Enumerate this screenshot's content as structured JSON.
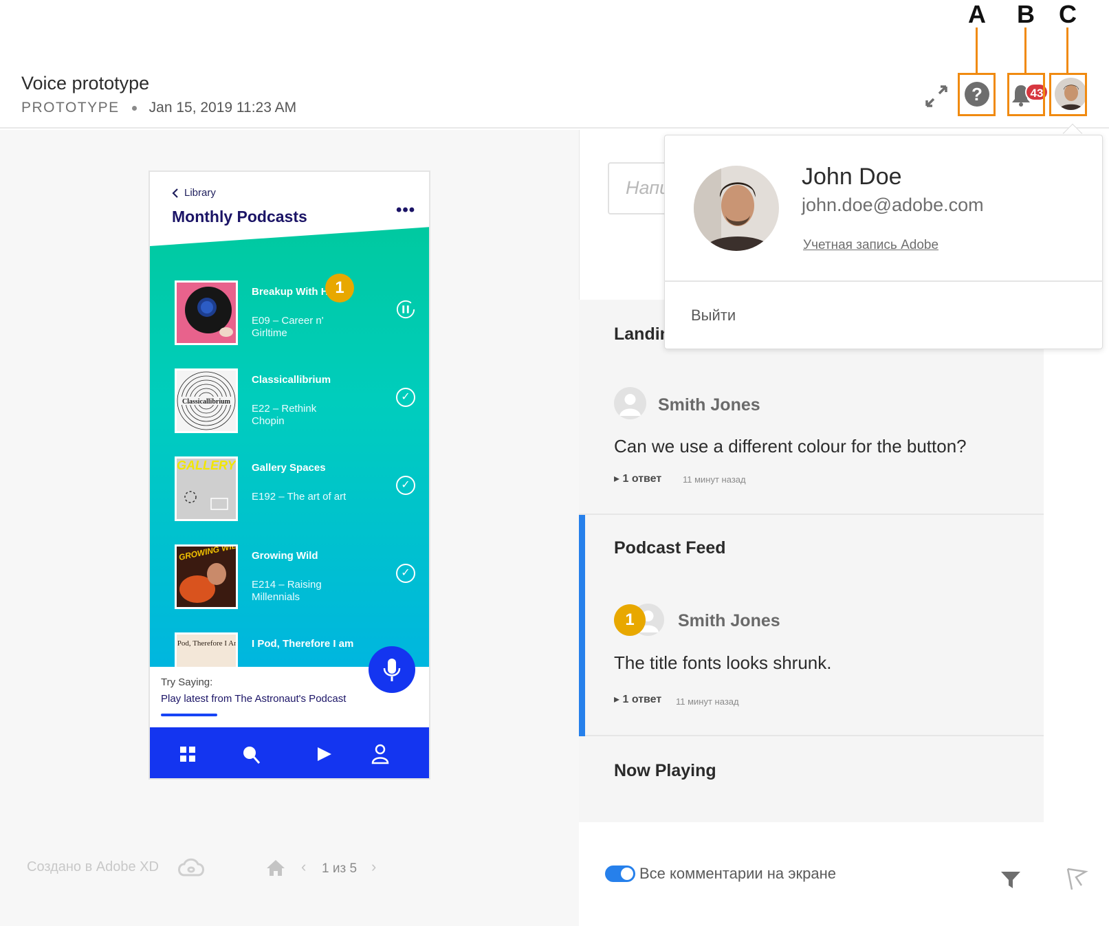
{
  "header": {
    "title": "Voice prototype",
    "type": "PROTOTYPE",
    "date": "Jan 15, 2019 11:23 AM",
    "notification_count": "43",
    "callouts": [
      "A",
      "B",
      "C"
    ]
  },
  "phone": {
    "back_label": "Library",
    "title": "Monthly Podcasts",
    "more": "•••",
    "podcasts": [
      {
        "name": "Breakup With H",
        "episode": "E09 – Career n' Girltime"
      },
      {
        "name": "Classicallibrium",
        "episode": "E22 – Rethink Chopin"
      },
      {
        "name": "Gallery Spaces",
        "episode": "E192 – The art of art"
      },
      {
        "name": "Growing Wild",
        "episode": "E214 – Raising Millennials"
      },
      {
        "name": "I Pod, Therefore I am",
        "episode": ""
      }
    ],
    "art_labels": {
      "classical": "Classicallibrium",
      "gallery": "GALLERY SPACES",
      "growing": "GROWING WILD",
      "ipod": "I Pod, Therefore I Am"
    },
    "marker": "1",
    "try_label": "Try Saying:",
    "try_phrase": "Play latest from The Astronaut's Podcast"
  },
  "canvas_footer": {
    "made_with": "Создано в Adobe XD",
    "pager": "1 из 5"
  },
  "panel": {
    "search_placeholder": "Напи",
    "groups": [
      {
        "title": "Landing",
        "author": "Smith Jones",
        "text": "Can we use a different colour for the button?",
        "replies": "1 ответ",
        "time": "11 минут назад"
      },
      {
        "title": "Podcast Feed",
        "marker": "1",
        "author": "Smith Jones",
        "text": "The title fonts looks shrunk.",
        "replies": "1 ответ",
        "time": "11 минут назад"
      },
      {
        "title": "Now Playing"
      }
    ],
    "toggle_label": "Все комментарии на экране"
  },
  "popover": {
    "name": "John Doe",
    "email": "john.doe@adobe.com",
    "account_link": "Учетная запись Adobe",
    "sign_out": "Выйти"
  },
  "colors": {
    "accent": "#2680eb",
    "callout": "#f08a10",
    "marker": "#e8a800",
    "phone_blue": "#1435f0",
    "badge": "#d7373f"
  }
}
